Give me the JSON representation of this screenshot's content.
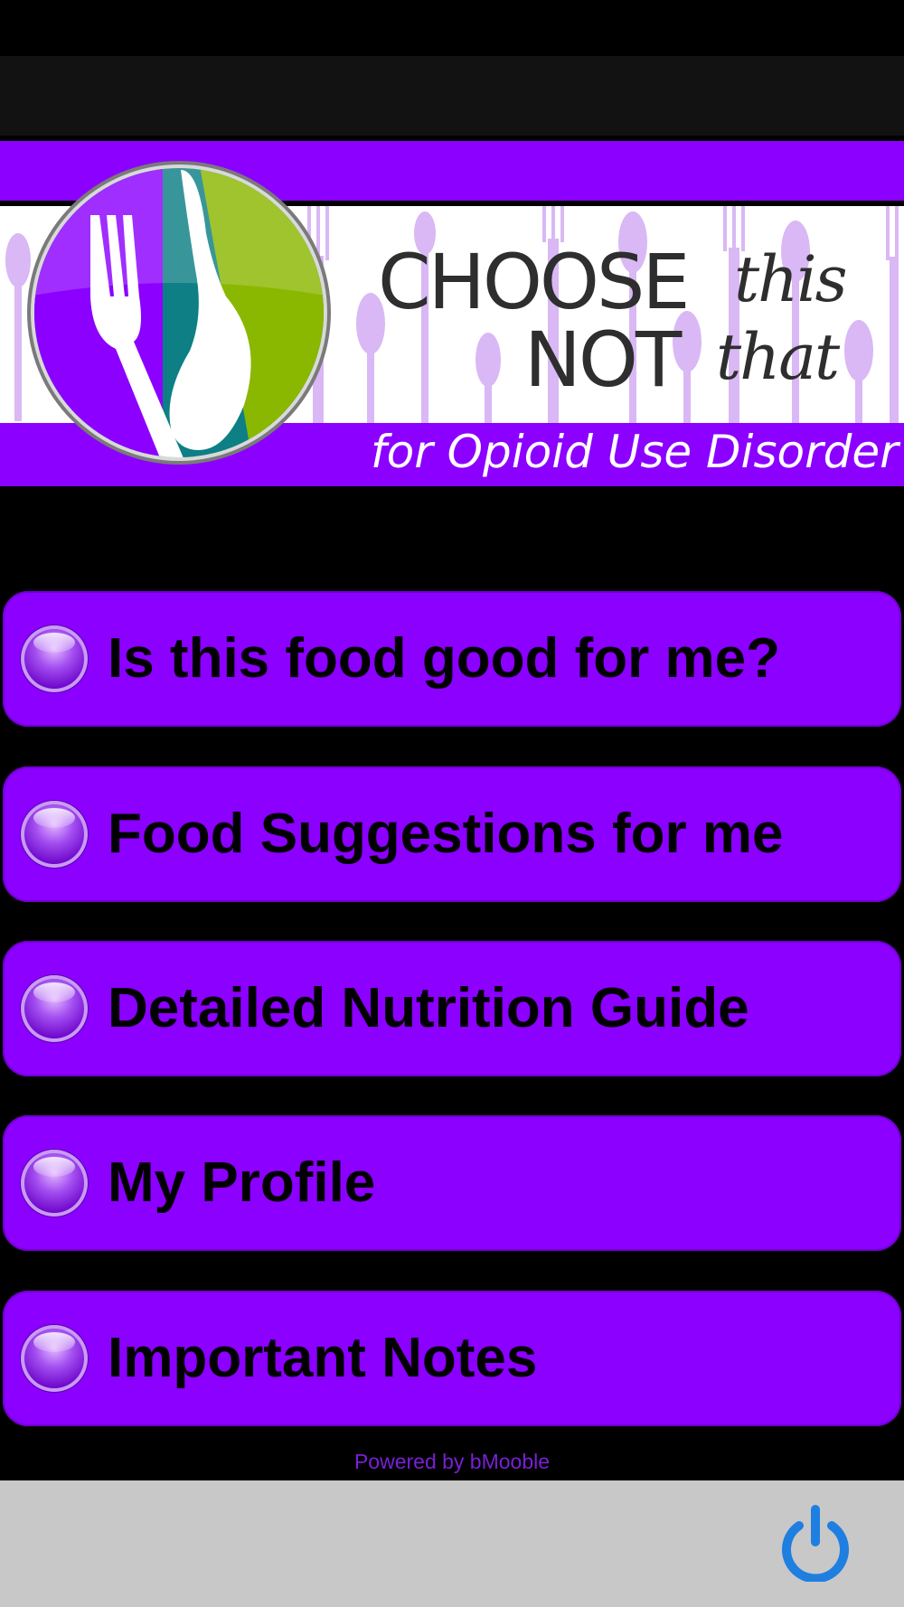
{
  "header": {
    "title_choose": "CHOOSE",
    "title_this": "this",
    "title_not": "NOT",
    "title_that": "that",
    "subtitle": "for Opioid Use Disorder"
  },
  "menu": {
    "items": [
      {
        "label": "Is this food good for me?",
        "name": "menu-item-is-this-food-good"
      },
      {
        "label": "Food Suggestions for me",
        "name": "menu-item-food-suggestions"
      },
      {
        "label": "Detailed Nutrition Guide",
        "name": "menu-item-nutrition-guide"
      },
      {
        "label": "My Profile",
        "name": "menu-item-my-profile"
      },
      {
        "label": "Important Notes",
        "name": "menu-item-important-notes"
      }
    ]
  },
  "footer": {
    "powered_by": "Powered by bMooble"
  },
  "toolbar": {
    "power_icon": "power-icon"
  },
  "colors": {
    "accent": "#8b00ff",
    "background": "#000000",
    "toolbar": "#c8c8c8",
    "power_icon": "#1e7fe0"
  }
}
